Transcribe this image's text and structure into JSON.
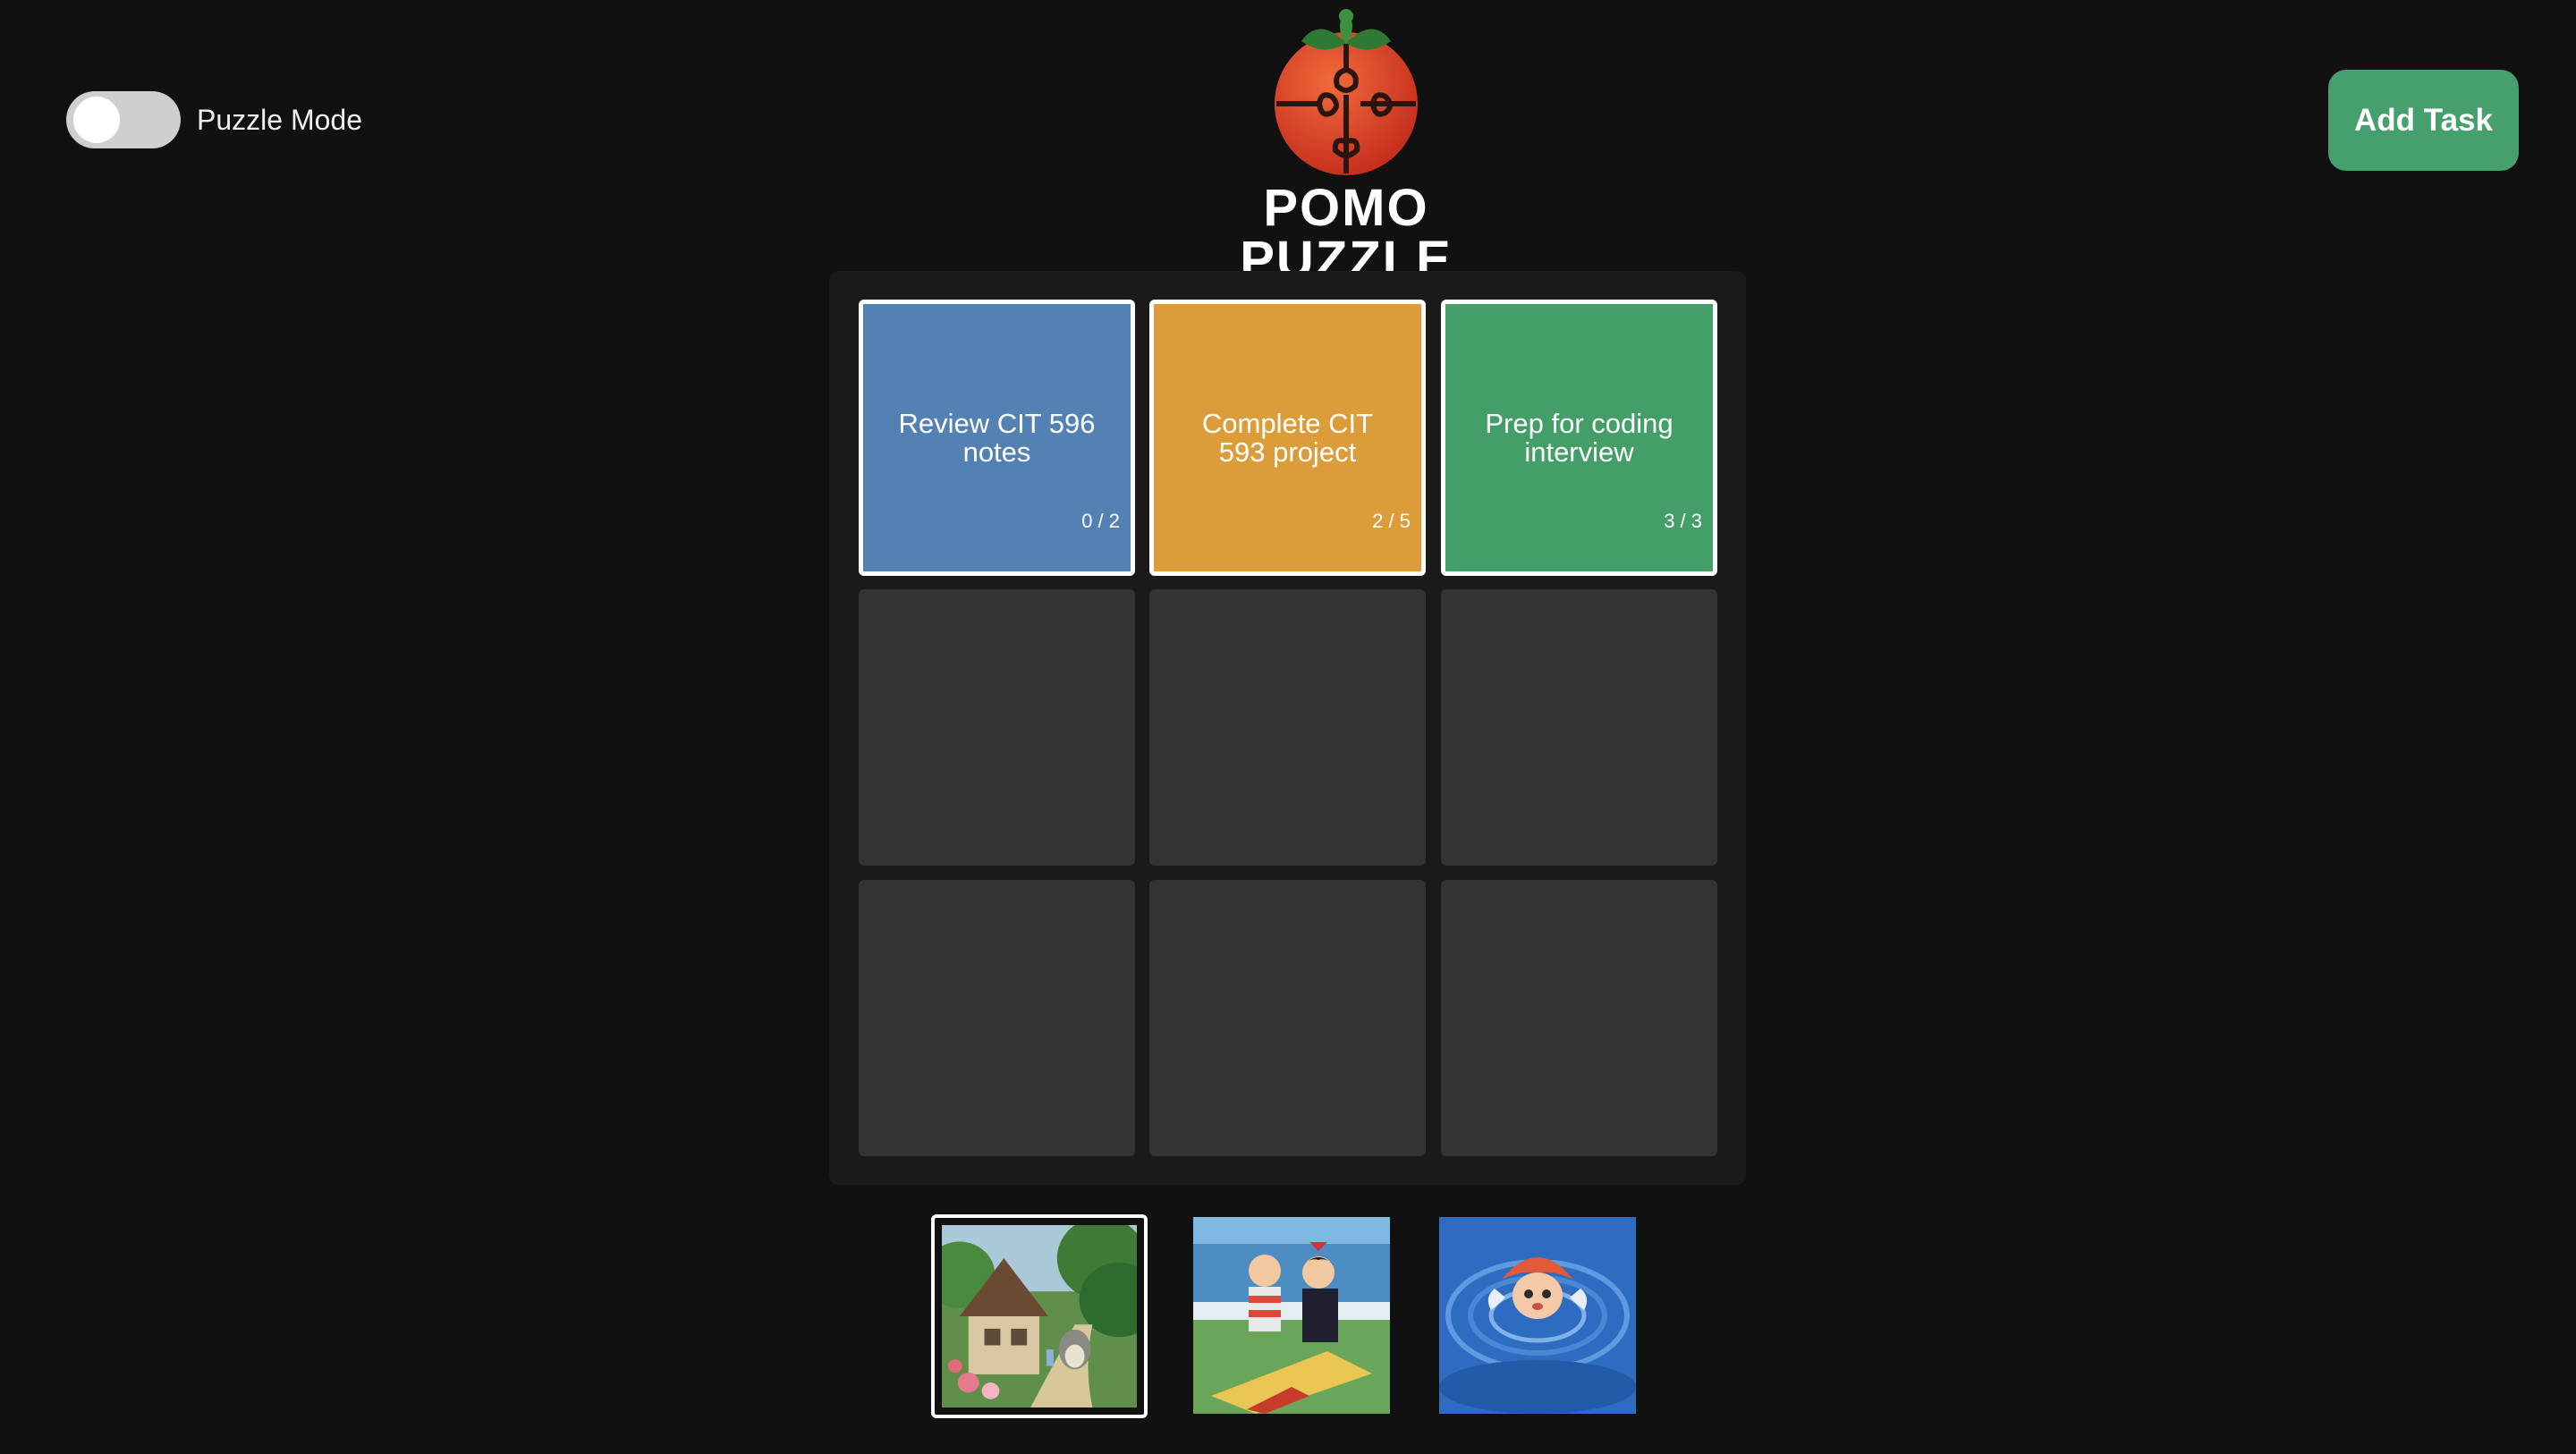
{
  "toggle": {
    "label": "Puzzle Mode",
    "on": false
  },
  "header": {
    "add_task_label": "Add Task",
    "logo_text": "POMO PUZZLE"
  },
  "tasks": [
    {
      "title": "Review CIT 596 notes",
      "progress": "0 / 2",
      "color": "#5381b4"
    },
    {
      "title": "Complete CIT 593 project",
      "progress": "2 / 5",
      "color": "#dc9c39"
    },
    {
      "title": "Prep for coding interview",
      "progress": "3 / 3",
      "color": "#449e68"
    }
  ],
  "thumbnails": [
    {
      "icon": "cottage-forest-image",
      "selected": true
    },
    {
      "icon": "beach-picnic-image",
      "selected": false
    },
    {
      "icon": "underwater-fish-girl-image",
      "selected": false
    }
  ],
  "colors": {
    "background": "#111111",
    "accent_green": "#46a06e",
    "empty_tile": "#333333"
  }
}
